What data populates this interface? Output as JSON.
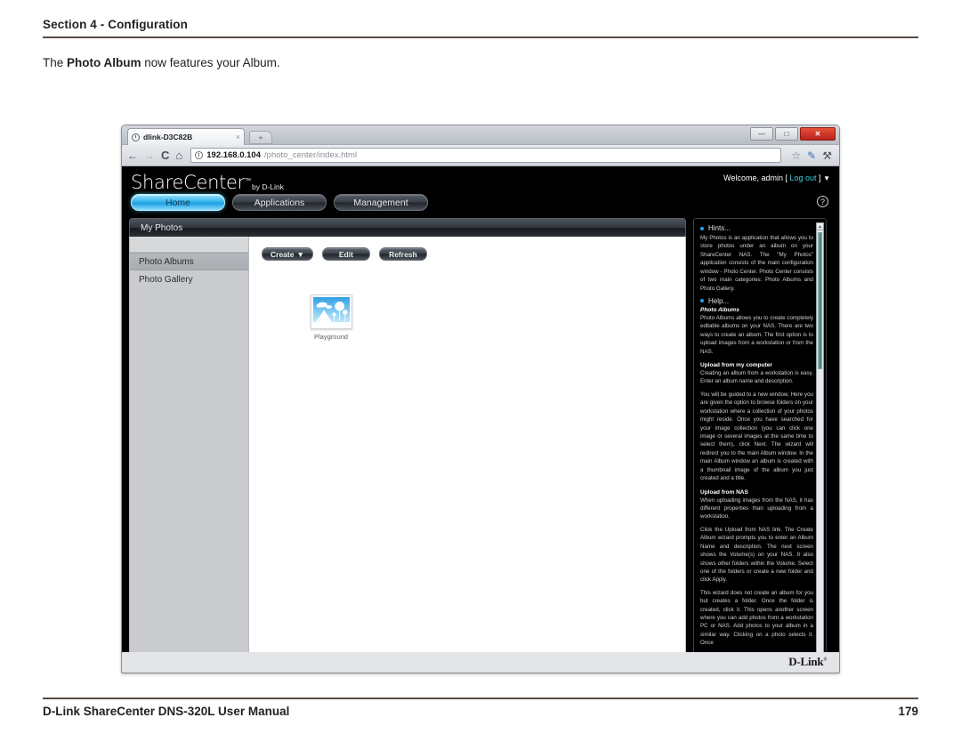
{
  "document": {
    "header_title": "Section 4 - Configuration",
    "intro_prefix": "The ",
    "intro_bold": "Photo Album",
    "intro_suffix": " now features your Album.",
    "footer_title": "D-Link ShareCenter DNS-320L User Manual",
    "page_number": "179"
  },
  "browser": {
    "tab_title": "dlink-D3C82B",
    "tab_close_glyph": "×",
    "new_tab_glyph": "+",
    "window_buttons": {
      "minimize": "—",
      "maximize": "□",
      "close": "✕"
    },
    "back_glyph": "←",
    "forward_glyph": "→",
    "reload_glyph": "C",
    "home_glyph": "⌂",
    "url_host": "192.168.0.104",
    "url_path": "/photo_center/index.html",
    "star_glyph": "☆",
    "pencil_glyph": "✎",
    "wrench_glyph": "⚒"
  },
  "app": {
    "brand_name": "ShareCenter",
    "brand_tm": "™",
    "brand_by": "by D-Link",
    "welcome_text": "Welcome, admin [ ",
    "logout_label": "Log out",
    "welcome_suffix": " ]",
    "welcome_caret": "▼",
    "help_glyph": "?",
    "nav_tabs": [
      {
        "label": "Home",
        "active": true
      },
      {
        "label": "Applications",
        "active": false
      },
      {
        "label": "Management",
        "active": false
      }
    ],
    "panel_title": "My Photos",
    "side_menu": [
      {
        "label": "Photo Albums",
        "active": true
      },
      {
        "label": "Photo Gallery",
        "active": false
      }
    ],
    "buttons": [
      {
        "label": "Create",
        "caret": "▼"
      },
      {
        "label": "Edit",
        "caret": ""
      },
      {
        "label": "Refresh",
        "caret": ""
      }
    ],
    "albums": [
      {
        "label": "Playground"
      }
    ],
    "footer_logo": "D-Link",
    "footer_logo_mark": "®"
  },
  "hints": {
    "hints_title": "Hints...",
    "hints_body": "My Photos is an application that allows you to store photos under an album on your ShareCenter NAS. The \"My Photos\" application consists of the main configuration window - Photo Center. Photo Center consists of two main categories: Photo Albums and Photo Gallery.",
    "help_title": "Help...",
    "photo_albums_heading": "Photo Albums",
    "photo_albums_body": "Photo Albums allows you to create completely editable albums on your NAS. There are two ways to create an album. The first option is to upload images from a workstation or from the NAS.",
    "upload_computer_heading": "Upload from my computer",
    "upload_computer_body1": "Creating an album from a workstation is easy. Enter an album name and description.",
    "upload_computer_body2": "You will be guided to a new window. Here you are given the option to browse folders on your workstation where a collection of your photos might reside. Once you have searched for your image collection (you can click one image or several images at the same time to select them), click Next. The wizard will redirect you to the main Album window. In the main Album window an album is created with a thumbnail image of the album you just created and a title.",
    "upload_nas_heading": "Upload from NAS",
    "upload_nas_body1": "When uploading images from the NAS, it has different properties than uploading from a workstation.",
    "upload_nas_body2": "Click the Upload from NAS link. The Create Album wizard prompts you to enter an Album Name and description. The next screen shows the Volume(s) on your NAS. It also shows other folders within the Volume. Select one of the folders or create a new folder and click Apply.",
    "upload_nas_body3": "This wizard does not create an album for you but creates a folder. Once the folder is created, click it. This opens another screen where you can add photos from a workstation PC or NAS. Add photos to your album in a similar way. Clicking on a photo selects it. Once",
    "scroll_up_glyph": "▲",
    "scroll_down_glyph": "▼"
  },
  "colors": {
    "accent_blue": "#1c9fe4",
    "link_cyan": "#36d0e8",
    "rule_brown": "#5b4a44",
    "scrollbar_teal": "#2f7d78"
  }
}
